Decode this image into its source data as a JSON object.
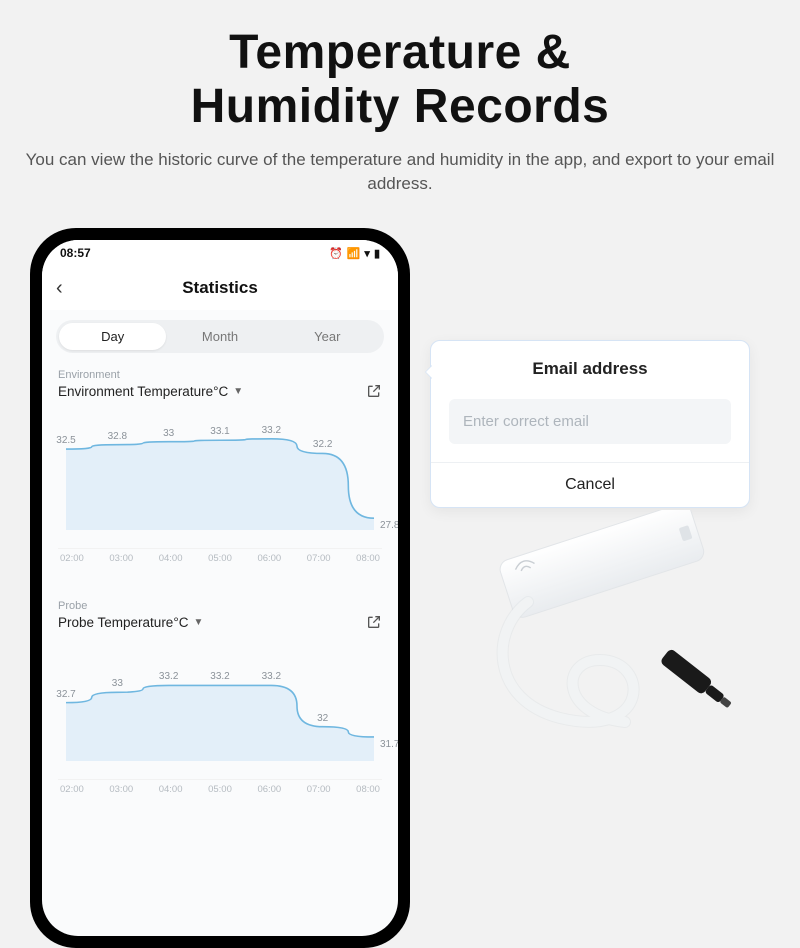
{
  "hero": {
    "title_l1": "Temperature &",
    "title_l2": "Humidity Records",
    "subtitle": "You can view the historic curve of the temperature and  humidity in the app, and export to your email address."
  },
  "phone": {
    "status_time": "08:57",
    "nav_title": "Statistics",
    "tabs": {
      "day": "Day",
      "month": "Month",
      "year": "Year"
    },
    "section1": {
      "group": "Environment",
      "title": "Environment Temperature°C"
    },
    "section2": {
      "group": "Probe",
      "title": "Probe Temperature°C"
    }
  },
  "popup": {
    "title": "Email address",
    "placeholder": "Enter correct email",
    "cancel": "Cancel"
  },
  "chart_data": [
    {
      "type": "line",
      "title": "Environment Temperature°C",
      "xlabel": "",
      "ylabel": "",
      "categories": [
        "02:00",
        "03:00",
        "04:00",
        "05:00",
        "06:00",
        "07:00",
        "08:00"
      ],
      "values": [
        32.5,
        32.8,
        33,
        33.1,
        33.2,
        32.2,
        27.8
      ],
      "ylim": [
        27,
        34
      ]
    },
    {
      "type": "line",
      "title": "Probe Temperature°C",
      "xlabel": "",
      "ylabel": "",
      "categories": [
        "02:00",
        "03:00",
        "04:00",
        "05:00",
        "06:00",
        "07:00",
        "08:00"
      ],
      "values": [
        32.7,
        33,
        33.2,
        33.2,
        33.2,
        32,
        31.7
      ],
      "ylim": [
        31,
        34
      ]
    }
  ]
}
